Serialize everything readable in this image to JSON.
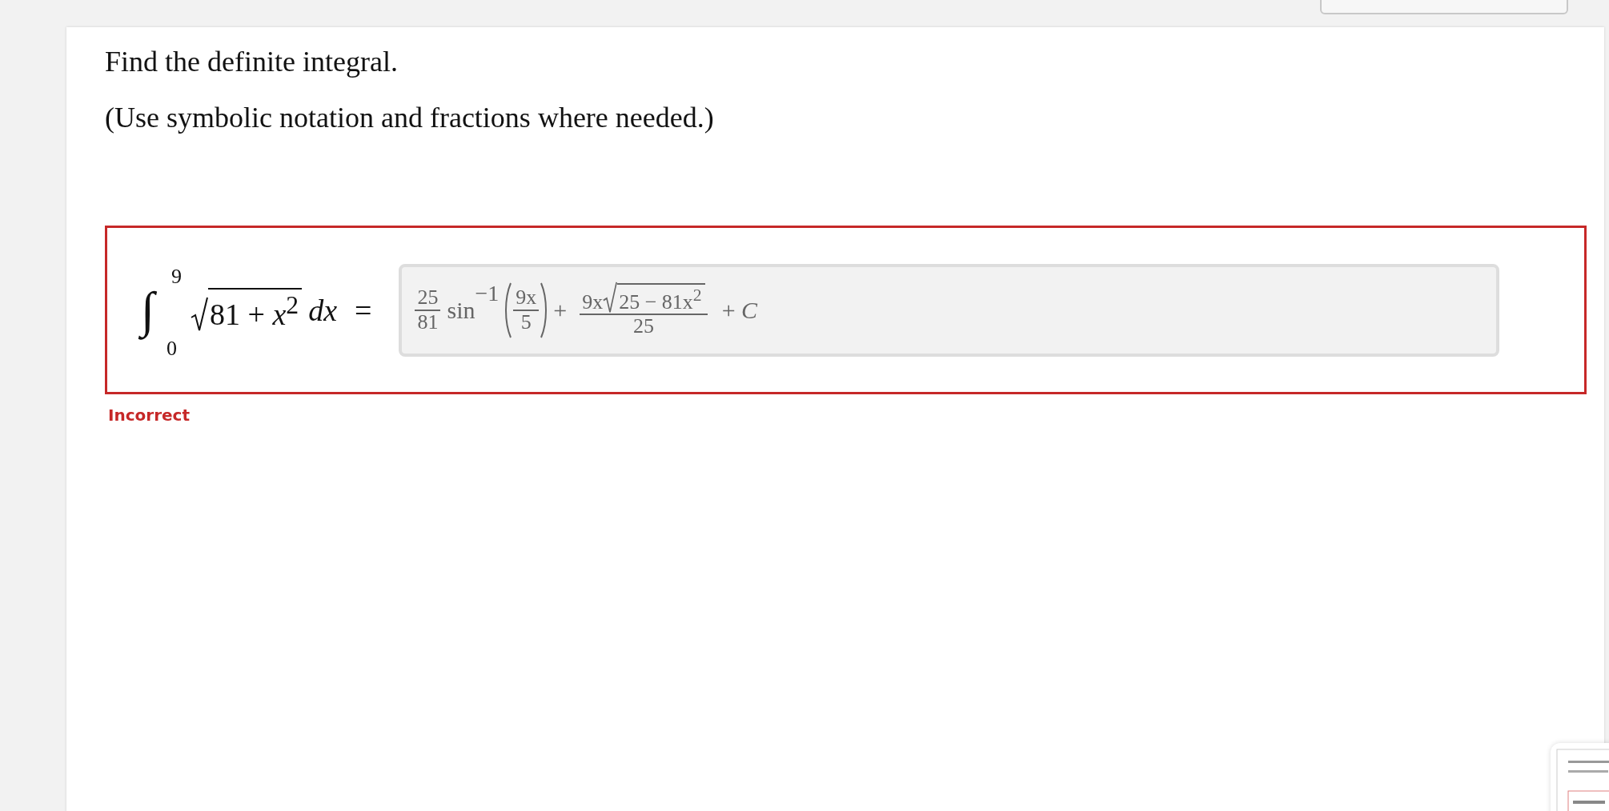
{
  "prompt": [
    "Find the definite integral.",
    "(Use symbolic notation and fractions where needed.)"
  ],
  "equation": {
    "integral_sign": "∫",
    "upper_limit": "9",
    "lower_limit": "0",
    "radicand": "81 + *x*$^{2}$",
    "differential": "*dx*",
    "relation": "="
  },
  "answer": {
    "coefficient": {
      "numerator": "25",
      "denominator": "81"
    },
    "function": "sin",
    "exponent": "−1",
    "argument": {
      "numerator": "9x",
      "denominator": "5"
    },
    "plus": "+",
    "fraction": {
      "prefix": "9x",
      "radicand": "25 − 81x$^{2}$",
      "denominator": "25"
    },
    "constant": "+ *C*"
  },
  "feedback": {
    "status": "Incorrect",
    "correct": false
  }
}
